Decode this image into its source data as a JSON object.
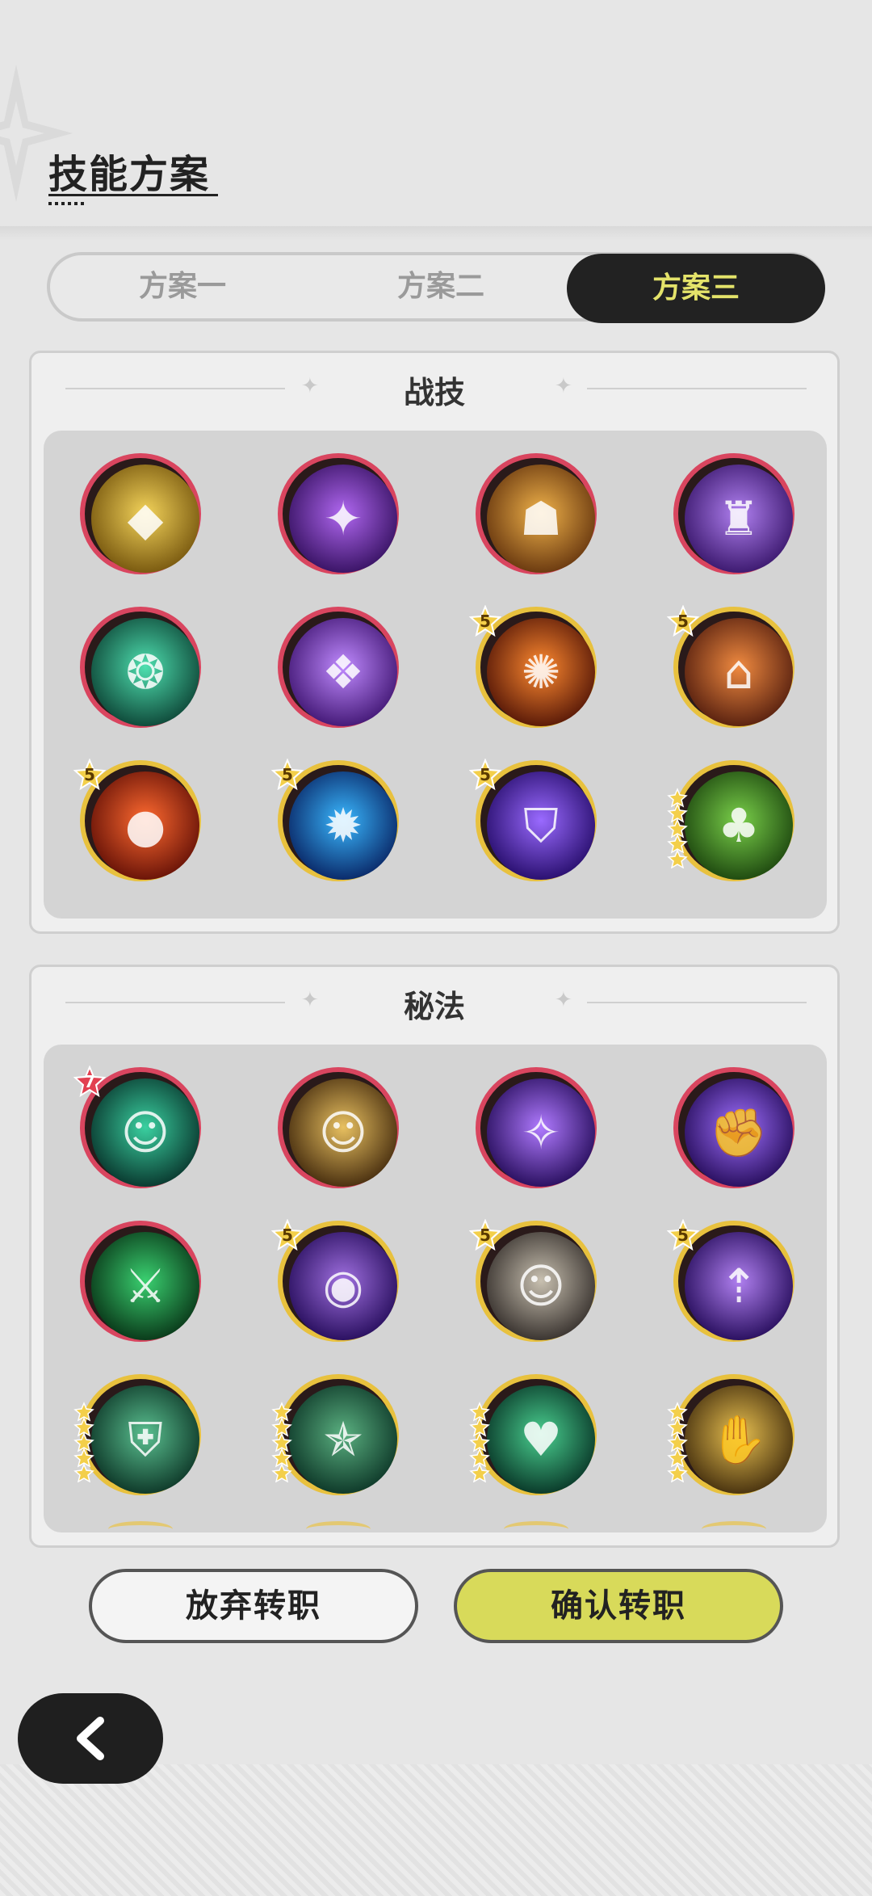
{
  "header": {
    "title": "技能方案"
  },
  "tabs": [
    {
      "label": "方案一",
      "active": false
    },
    {
      "label": "方案二",
      "active": false
    },
    {
      "label": "方案三",
      "active": true
    }
  ],
  "combat_section": {
    "title": "战技",
    "skills": [
      {
        "icon": "golden-crystal-icon",
        "frame": "red",
        "badge": null
      },
      {
        "icon": "purple-star-burst-icon",
        "frame": "red",
        "badge": null
      },
      {
        "icon": "stone-golem-icon",
        "frame": "red",
        "badge": null
      },
      {
        "icon": "purple-guardian-icon",
        "frame": "red",
        "badge": null
      },
      {
        "icon": "green-wind-spirit-icon",
        "frame": "red",
        "badge": null
      },
      {
        "icon": "purple-rune-flame-icon",
        "frame": "red",
        "badge": null
      },
      {
        "icon": "fire-swirl-icon",
        "frame": "gold",
        "badge": "5"
      },
      {
        "icon": "orange-house-shield-icon",
        "frame": "gold",
        "badge": "5"
      },
      {
        "icon": "fireball-icon",
        "frame": "gold",
        "badge": "5"
      },
      {
        "icon": "blue-flame-icon",
        "frame": "gold",
        "badge": "5"
      },
      {
        "icon": "purple-shield-icon",
        "frame": "gold",
        "badge": "5"
      },
      {
        "icon": "tree-stump-icon",
        "frame": "gold",
        "badge": "stars5"
      }
    ]
  },
  "arcane_section": {
    "title": "秘法",
    "skills": [
      {
        "icon": "green-figure-aura-icon",
        "frame": "red",
        "badge": "7"
      },
      {
        "icon": "golden-figure-icon",
        "frame": "red",
        "badge": null
      },
      {
        "icon": "purple-orb-star-icon",
        "frame": "red",
        "badge": null
      },
      {
        "icon": "purple-arm-strike-icon",
        "frame": "red",
        "badge": null
      },
      {
        "icon": "green-sword-rune-icon",
        "frame": "red",
        "badge": null
      },
      {
        "icon": "purple-eye-figure-icon",
        "frame": "gold",
        "badge": "5"
      },
      {
        "icon": "gray-figure-icon",
        "frame": "gold",
        "badge": "5"
      },
      {
        "icon": "purple-figure-arrows-icon",
        "frame": "gold",
        "badge": "5"
      },
      {
        "icon": "green-shield-icon",
        "frame": "gold",
        "badge": "stars5"
      },
      {
        "icon": "winged-star-icon",
        "frame": "gold",
        "badge": "stars5"
      },
      {
        "icon": "green-heart-icon",
        "frame": "gold",
        "badge": "stars5"
      },
      {
        "icon": "golden-hand-icon",
        "frame": "gold",
        "badge": "stars5"
      }
    ]
  },
  "buttons": {
    "abandon": "放弃转职",
    "confirm": "确认转职"
  },
  "colors": {
    "red_frame": "#d9455f",
    "gold_frame": "#e8c13e",
    "active_tab_text": "#e4e36a",
    "confirm_bg": "#d8da5a"
  },
  "back_button": {
    "icon": "chevron-left-icon"
  }
}
